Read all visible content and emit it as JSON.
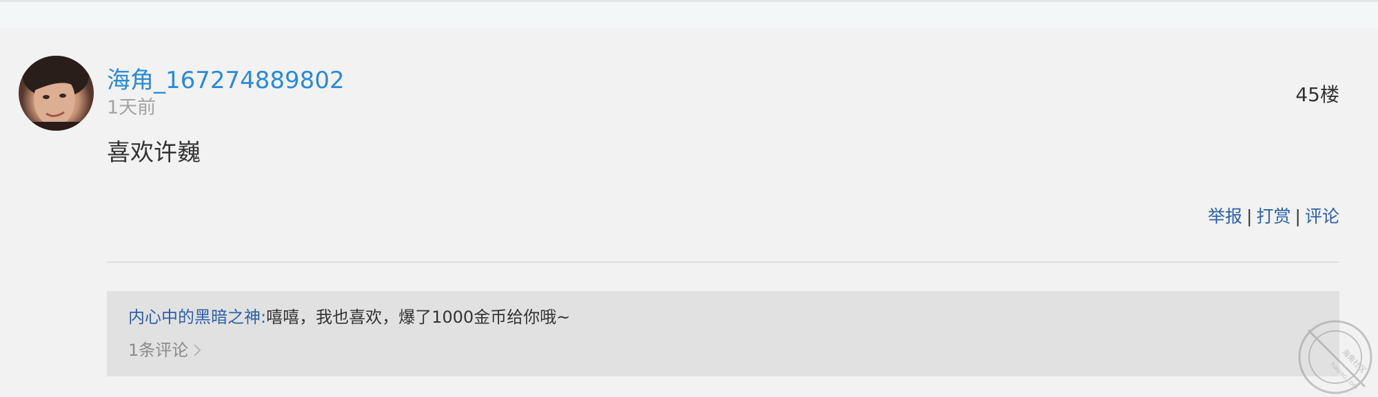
{
  "post": {
    "username": "海角_167274889802",
    "time": "1天前",
    "floor": "45楼",
    "content": "喜欢许巍",
    "actions": {
      "report": "举报",
      "tip": "打赏",
      "comment": "评论",
      "separator": "|"
    }
  },
  "comments": {
    "reply_user": "内心中的黑暗之神:",
    "reply_text": "嘻嘻，我也喜欢，爆了1000金币给你哦~",
    "count_label": "1条评论"
  },
  "watermark": {
    "text": "海角社区",
    "url": "haijiao.com"
  },
  "colors": {
    "username": "#2b8ad6",
    "link": "#2e5fa8",
    "muted": "#a3a3a3",
    "text": "#333333",
    "post_bg": "#f1f2f1",
    "comment_bg": "#e1e1e1"
  },
  "icons": {
    "comment_chevron": "chevron-right-icon",
    "watermark": "watermark-stamp-icon"
  }
}
